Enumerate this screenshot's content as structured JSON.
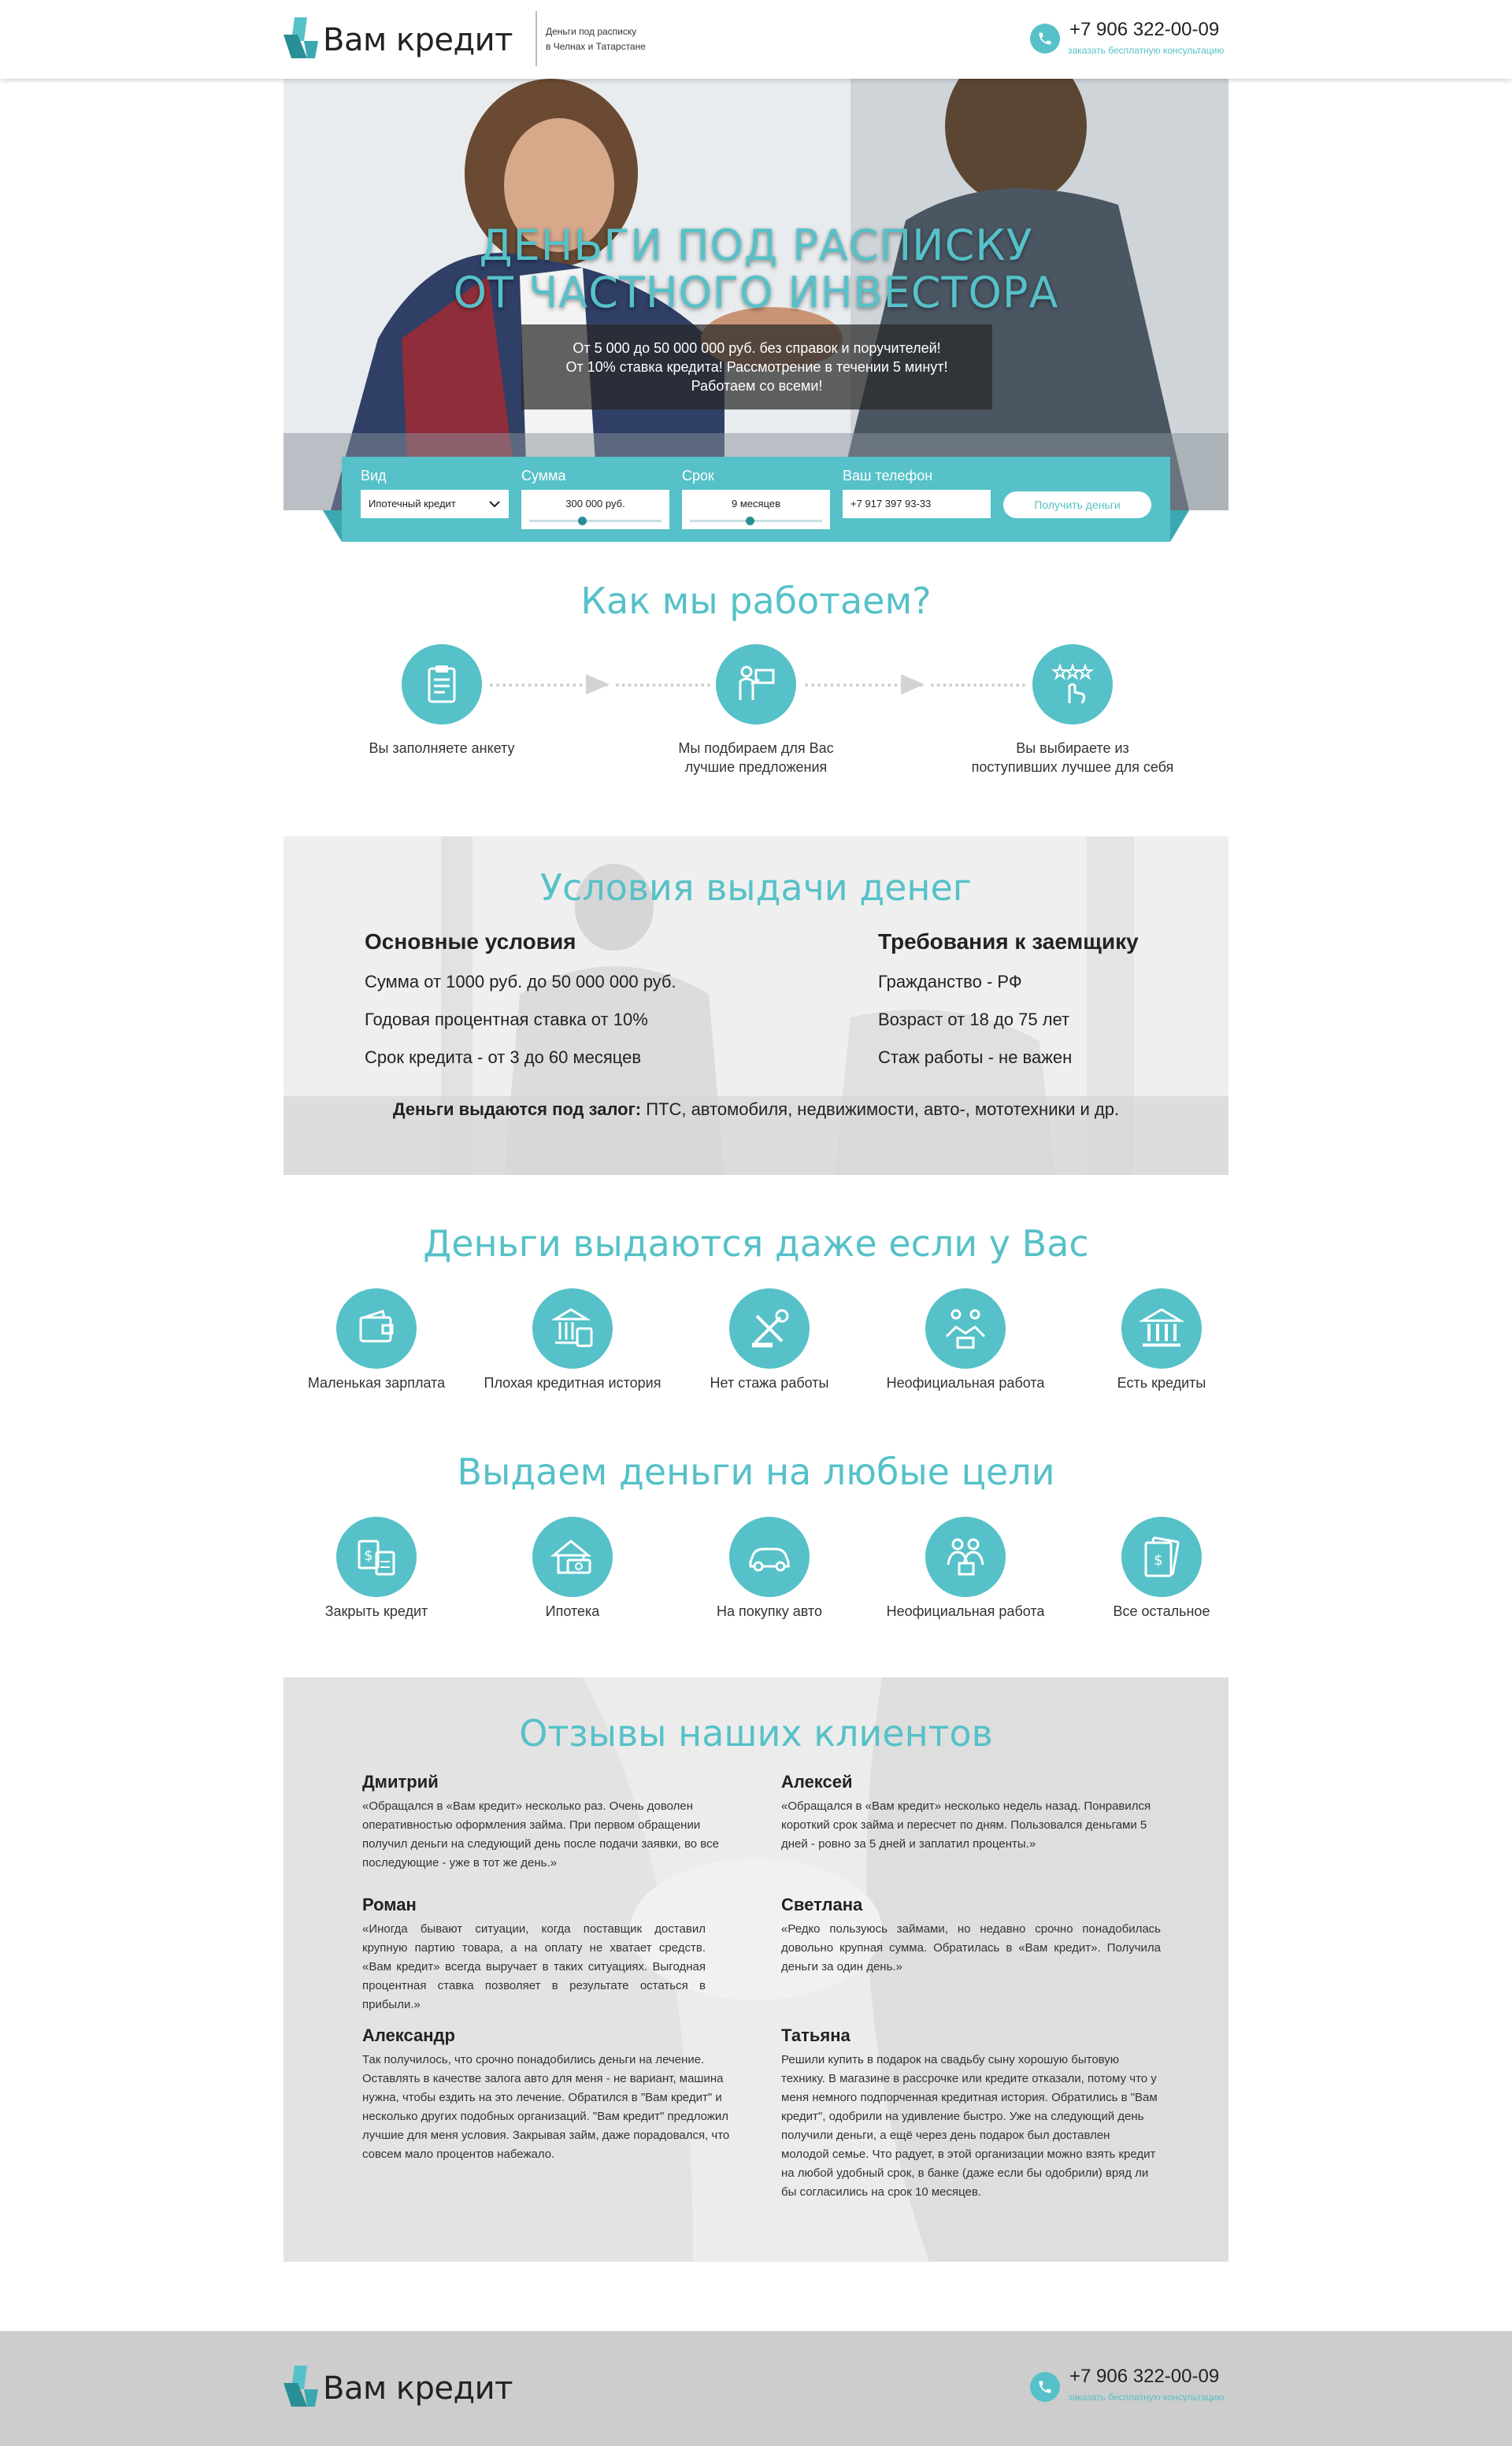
{
  "header": {
    "logo_text": "Вам кредит",
    "tagline_line1": "Деньги под расписку",
    "tagline_line2": "в Челнах и Татарстане",
    "phone": "+7 906 322-00-09",
    "consult_link": "заказать бесплатную консультацию"
  },
  "hero": {
    "title_line1": "ДЕНЬГИ ПОД РАСПИСКУ",
    "title_line2": "ОТ ЧАСТНОГО ИНВЕСТОРА",
    "sub_line1": "От 5 000 до 50 000 000 руб. без справок и поручителей!",
    "sub_line2": "От 10% ставка кредита! Рассмотрение в течении 5 минут!",
    "sub_line3": "Работаем со всеми!"
  },
  "form": {
    "type_label": "Вид",
    "type_value": "Ипотечный кредит",
    "sum_label": "Сумма",
    "sum_value": "300 000 руб.",
    "sum_level": 0.4,
    "term_label": "Срок",
    "term_value": "9 месяцев",
    "term_level": 0.45,
    "phone_label": "Ваш телефон",
    "phone_value": "+7 917 397 93-33",
    "submit": "Получить деньги"
  },
  "how": {
    "title": "Как мы работаем?",
    "steps": [
      {
        "icon": "clipboard-icon",
        "text_line1": "Вы заполняете анкету",
        "text_line2": ""
      },
      {
        "icon": "presenter-icon",
        "text_line1": "Мы подбираем для Вас",
        "text_line2": "лучшие предложения"
      },
      {
        "icon": "hand-stars-icon",
        "text_line1": "Вы выбираете из",
        "text_line2": "поступивших лучшее для себя"
      }
    ]
  },
  "conditions": {
    "title": "Условия выдачи денег",
    "left_heading": "Основные условия",
    "left_items": [
      "Сумма от 1000 руб. до 50 000 000 руб.",
      "Годовая процентная ставка от 10%",
      "Срок кредита - от 3 до 60 месяцев"
    ],
    "right_heading": "Требования к заемщику",
    "right_items": [
      "Гражданство - РФ",
      "Возраст от 18 до 75 лет",
      "Стаж работы - не важен"
    ],
    "collateral_bold": "Деньги выдаются под залог:",
    "collateral_text": "ПТС, автомобиля, недвижимости, авто-, мототехники и др."
  },
  "even_if": {
    "title": "Деньги выдаются даже если у Вас",
    "items": [
      {
        "icon": "wallet-icon",
        "label": "Маленькая зарплата"
      },
      {
        "icon": "bank-card-icon",
        "label": "Плохая кредитная история"
      },
      {
        "icon": "tools-icon",
        "label": "Нет стажа работы"
      },
      {
        "icon": "handshake-icon",
        "label": "Неофициальная работа"
      },
      {
        "icon": "bank-icon",
        "label": "Есть кредиты"
      }
    ]
  },
  "purposes": {
    "title": "Выдаем деньги на любые цели",
    "items": [
      {
        "icon": "calculator-icon",
        "label": "Закрыть кредит"
      },
      {
        "icon": "house-money-icon",
        "label": "Ипотека"
      },
      {
        "icon": "car-icon",
        "label": "На покупку авто"
      },
      {
        "icon": "business-people-icon",
        "label": "Неофициальная работа"
      },
      {
        "icon": "cash-icon",
        "label": "Все остальное"
      }
    ]
  },
  "reviews": {
    "title": "Отзывы наших клиентов",
    "items": [
      {
        "name": "Дмитрий",
        "text": "«Обращался в «Вам кредит» несколько раз. Очень доволен оперативностью оформления займа. При первом обращении получил деньги на следующий день после подачи заявки, во все последующие - уже в тот же день.»"
      },
      {
        "name": "Алексей",
        "text": "«Обращался в «Вам кредит» несколько недель назад. Понравился короткий срок займа и пересчет по дням. Пользовался деньгами 5 дней - ровно за 5 дней и заплатил проценты.»"
      },
      {
        "name": "Роман",
        "text": "«Иногда бывают ситуации, когда поставщик доставил крупную партию товара, а на оплату не хватает средств. «Вам кредит» всегда выручает в таких ситуациях. Выгодная процентная ставка позволяет в результате остаться в прибыли.»"
      },
      {
        "name": "Светлана",
        "text": "«Редко пользуюсь займами, но недавно срочно понадобилась довольно крупная сумма. Обратилась в «Вам кредит». Получила деньги за один день.»"
      },
      {
        "name": "Александр",
        "text": "Так получилось, что срочно понадобились деньги на лечение. Оставлять в качестве залога авто для меня - не вариант, машина нужна, чтобы ездить на это лечение. Обратился в \"Вам кредит\" и несколько других подобных организаций. \"Вам кредит\" предложил лучшие для меня условия. Закрывая займ, даже порадовался, что совсем мало процентов набежало."
      },
      {
        "name": "Татьяна",
        "text": "Решили купить в подарок на свадьбу сыну хорошую бытовую технику. В магазине в рассрочке или кредите отказали, потому что у меня немного подпорченная кредитная история. Обратились в \"Вам кредит\", одобрили на удивление быстро. Уже на следующий день получили деньги, а ещё через день подарок был доставлен молодой семье. Что радует, в этой организации можно взять кредит на любой удобный срок, в банке (даже если бы одобрили) вряд ли бы согласились на срок 10 месяцев."
      }
    ]
  },
  "footer": {
    "logo_text": "Вам кредит",
    "phone": "+7 906 322-00-09",
    "consult_link": "заказать бесплатную консультацию"
  },
  "colors": {
    "accent": "#56c1c8",
    "dark_text": "#222222",
    "footer_bg": "#cdcdcd"
  }
}
